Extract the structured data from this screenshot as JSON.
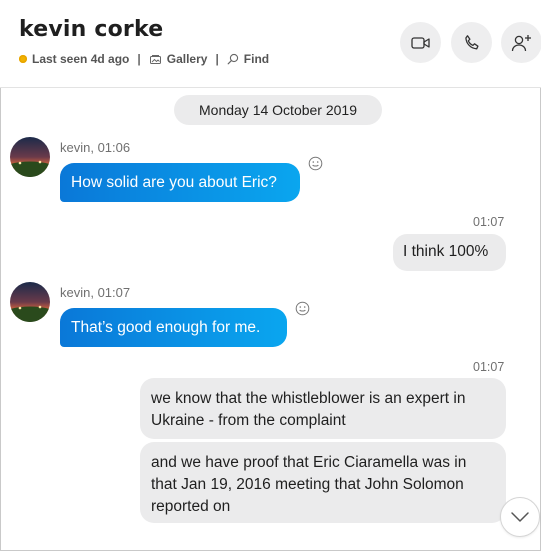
{
  "header": {
    "contact_name": "kevin corke",
    "status_text": "Last seen 4d ago",
    "gallery_label": "Gallery",
    "find_label": "Find",
    "separator": "|"
  },
  "date_divider": "Monday 14 October 2019",
  "messages": [
    {
      "sender": "kevin, 01:06",
      "text": "How solid are you about Eric?",
      "direction": "incoming"
    },
    {
      "time": "01:07",
      "text": "I think 100%",
      "direction": "outgoing"
    },
    {
      "sender": "kevin, 01:07",
      "text": "That’s good enough for me.",
      "direction": "incoming"
    },
    {
      "time": "01:07",
      "text": "we know that the whistleblower is an expert in Ukraine - from the complaint",
      "direction": "outgoing"
    },
    {
      "text": "and we have proof that Eric Ciaramella was in that Jan 19, 2016 meeting that John Solomon reported on",
      "direction": "outgoing"
    }
  ],
  "colors": {
    "incoming_start": "#0a78d8",
    "incoming_end": "#0aa6ef",
    "outgoing_bg": "#ebebec",
    "status_dot": "#f2b200"
  },
  "icons": [
    "video-call-icon",
    "audio-call-icon",
    "add-person-icon",
    "gallery-icon",
    "find-icon",
    "smiley-react-icon",
    "chevron-down-icon"
  ]
}
